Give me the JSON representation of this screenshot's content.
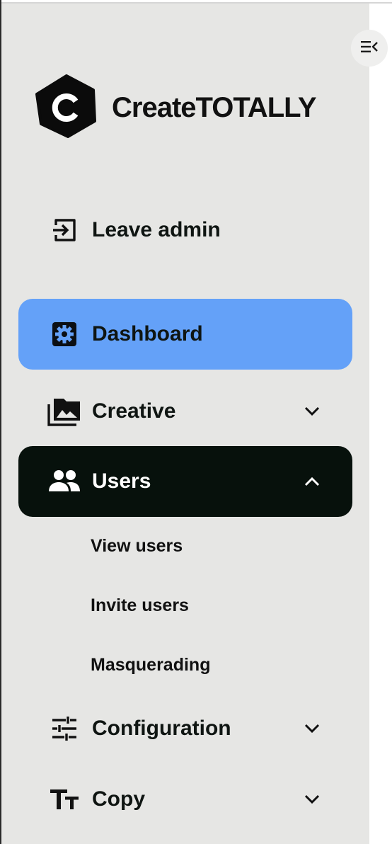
{
  "brand": {
    "name": "CreateTOTALLY"
  },
  "sidebar": {
    "collapse_icon": "collapse-sidebar-icon",
    "leave_admin": {
      "label": "Leave admin",
      "icon": "exit-icon"
    },
    "items": [
      {
        "label": "Dashboard",
        "icon": "gear-icon",
        "state": "selected"
      },
      {
        "label": "Creative",
        "icon": "image-library-icon",
        "state": "collapsed"
      },
      {
        "label": "Users",
        "icon": "people-icon",
        "state": "expanded"
      },
      {
        "label": "Configuration",
        "icon": "sliders-icon",
        "state": "collapsed"
      },
      {
        "label": "Copy",
        "icon": "text-size-icon",
        "state": "collapsed"
      }
    ],
    "users_subitems": [
      "View users",
      "Invite users",
      "Masquerading"
    ]
  },
  "colors": {
    "sidebar_bg": "#e6e6e4",
    "selected_bg": "#64a1f8",
    "expanded_bg": "#07110c"
  }
}
